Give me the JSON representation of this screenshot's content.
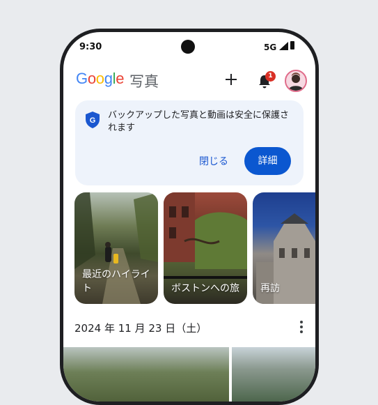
{
  "status_bar": {
    "time": "9:30",
    "network": "5G"
  },
  "app_bar": {
    "logo_letters": [
      {
        "ch": "G",
        "color": "#4285F4"
      },
      {
        "ch": "o",
        "color": "#EA4335"
      },
      {
        "ch": "o",
        "color": "#FBBC05"
      },
      {
        "ch": "g",
        "color": "#4285F4"
      },
      {
        "ch": "l",
        "color": "#34A853"
      },
      {
        "ch": "e",
        "color": "#EA4335"
      }
    ],
    "title": "写真",
    "notification_count": "1",
    "icons": [
      "plus-icon",
      "bell-icon",
      "avatar"
    ]
  },
  "backup_card": {
    "message": "バックアップした写真と動画は安全に保護されます",
    "dismiss_label": "閉じる",
    "details_label": "詳細",
    "accent": "#0B57D0"
  },
  "memories": [
    {
      "label": "最近のハイライト"
    },
    {
      "label": "ボストンへの旅"
    },
    {
      "label": "再訪"
    }
  ],
  "date_header": {
    "date": "2024 年 11 月 23 日（土）"
  }
}
